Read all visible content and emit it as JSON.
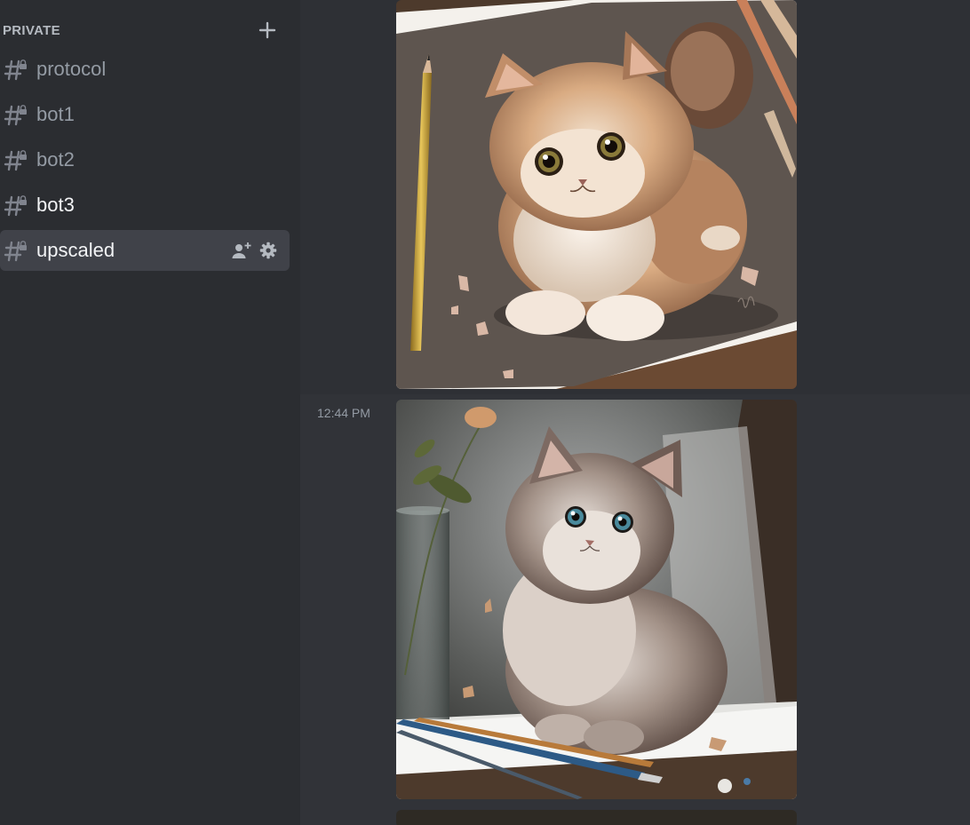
{
  "sidebar": {
    "category": "PRIVATE",
    "channels": [
      {
        "name": "protocol",
        "state": "normal"
      },
      {
        "name": "bot1",
        "state": "normal"
      },
      {
        "name": "bot2",
        "state": "normal"
      },
      {
        "name": "bot3",
        "state": "unread"
      },
      {
        "name": "upscaled",
        "state": "selected"
      }
    ]
  },
  "chat": {
    "messages": [
      {
        "timestamp": "",
        "image": "kitten-pencil-drawing"
      },
      {
        "timestamp": "12:44 PM",
        "image": "kitten-with-brushes"
      }
    ]
  },
  "icons": {
    "category_add": "plus-icon",
    "channel": "locked-hash-icon",
    "invite": "add-member-icon",
    "settings": "gear-icon"
  },
  "colors": {
    "sidebar_bg": "#2b2d31",
    "chat_bg": "#313338",
    "selected_bg": "#404249",
    "muted_text": "#949ba4",
    "bright_text": "#f2f3f5"
  }
}
